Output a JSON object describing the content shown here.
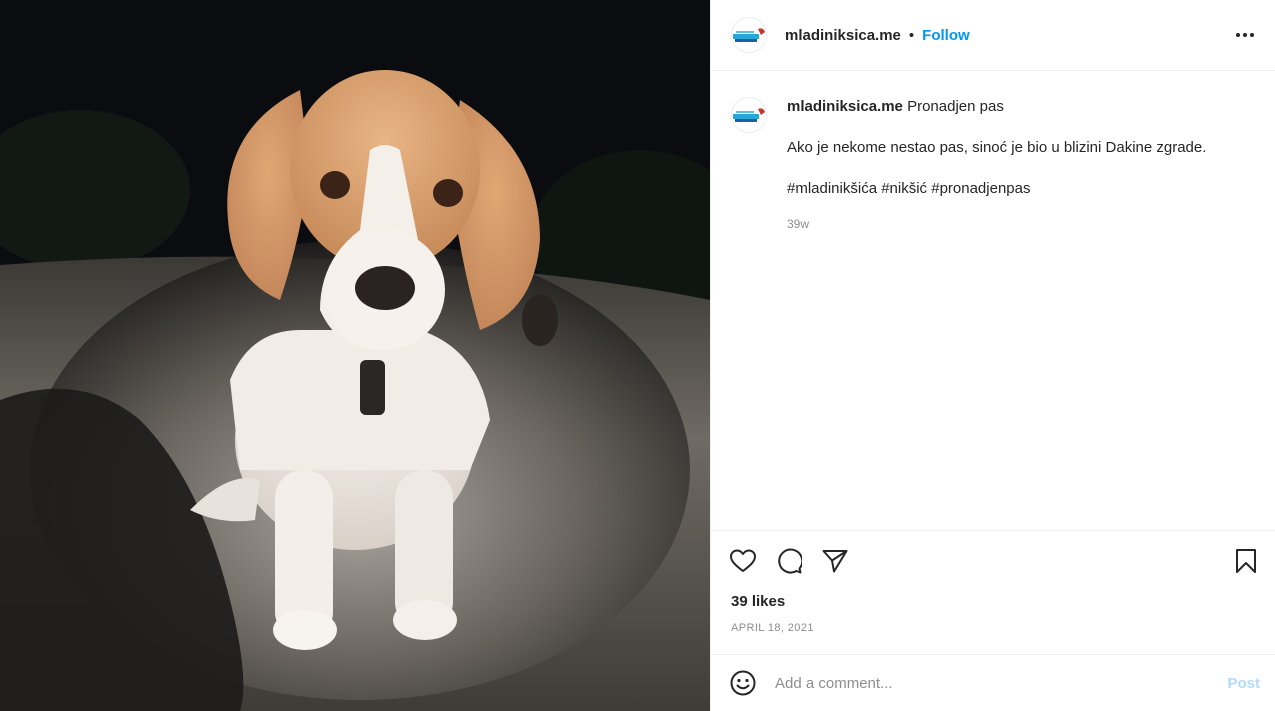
{
  "post": {
    "image_alt": "Beagle dog sitting on a path at night",
    "username": "mladiniksica.me",
    "separator": "•",
    "follow_label": "Follow",
    "more_icon": "more-horizontal-icon"
  },
  "caption": {
    "username": "mladiniksica.me",
    "title": "Pronadjen pas",
    "text": "Ako je nekome nestao pas, sinoć je bio u blizini Dakine zgrade.",
    "hashtags": "#mladinikšića #nikšić #pronadjenpas",
    "time_ago": "39w"
  },
  "actions": {
    "like_icon": "heart-icon",
    "comment_icon": "comment-icon",
    "share_icon": "share-icon",
    "save_icon": "bookmark-icon"
  },
  "likes": "39 likes",
  "date": "April 18, 2021",
  "comment": {
    "placeholder": "Add a comment...",
    "value": "",
    "post_label": "Post",
    "emoji_icon": "emoji-icon"
  },
  "colors": {
    "accent": "#0095f6",
    "post_disabled": "#b3dbff",
    "muted": "#8e8e8e"
  }
}
